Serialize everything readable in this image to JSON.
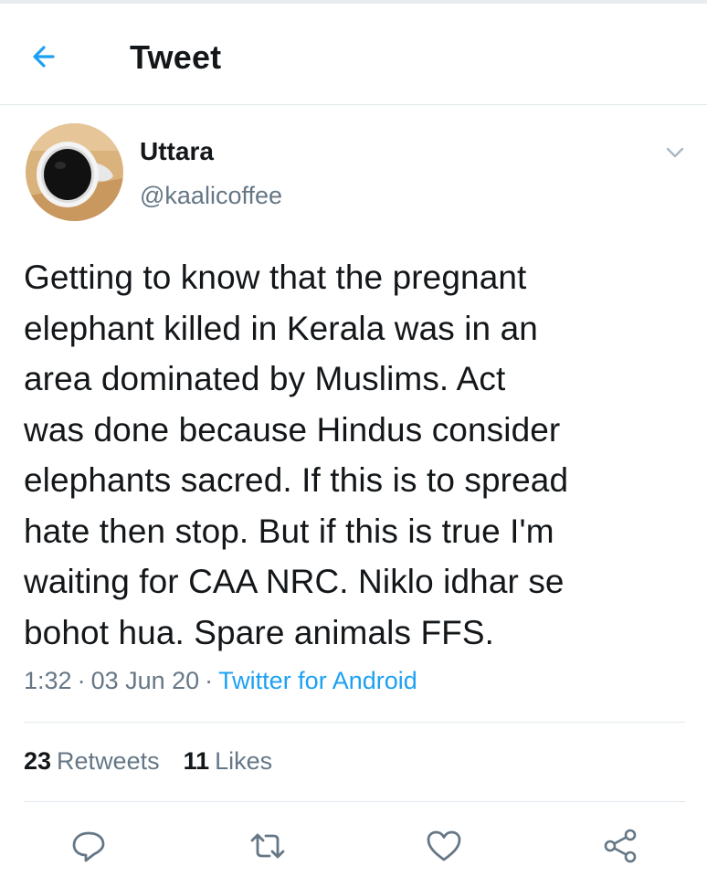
{
  "header": {
    "title": "Tweet",
    "back_icon": "arrow-left-icon"
  },
  "colors": {
    "accent": "#1da1f2",
    "secondary_text": "#657786",
    "divider": "#e1e8ed"
  },
  "tweet": {
    "author": {
      "display_name": "Uttara",
      "handle": "@kaalicoffee",
      "avatar": "coffee-cup-avatar"
    },
    "text": "Getting to know that the pregnant\nelephant killed in Kerala was in an\narea dominated by Muslims. Act\nwas done because Hindus consider\nelephants sacred. If this is to spread\nhate then stop. But if this is true I'm\nwaiting for CAA NRC. Niklo idhar se\nbohot hua. Spare animals FFS.",
    "time": "1:32",
    "date": "03 Jun 20",
    "separator": "·",
    "source": "Twitter for Android",
    "stats": {
      "retweets_count": "23",
      "retweets_label": "Retweets",
      "likes_count": "11",
      "likes_label": "Likes"
    }
  },
  "actions": [
    {
      "name": "reply",
      "icon": "reply-icon"
    },
    {
      "name": "retweet",
      "icon": "retweet-icon"
    },
    {
      "name": "like",
      "icon": "heart-icon"
    },
    {
      "name": "share",
      "icon": "share-icon"
    }
  ]
}
